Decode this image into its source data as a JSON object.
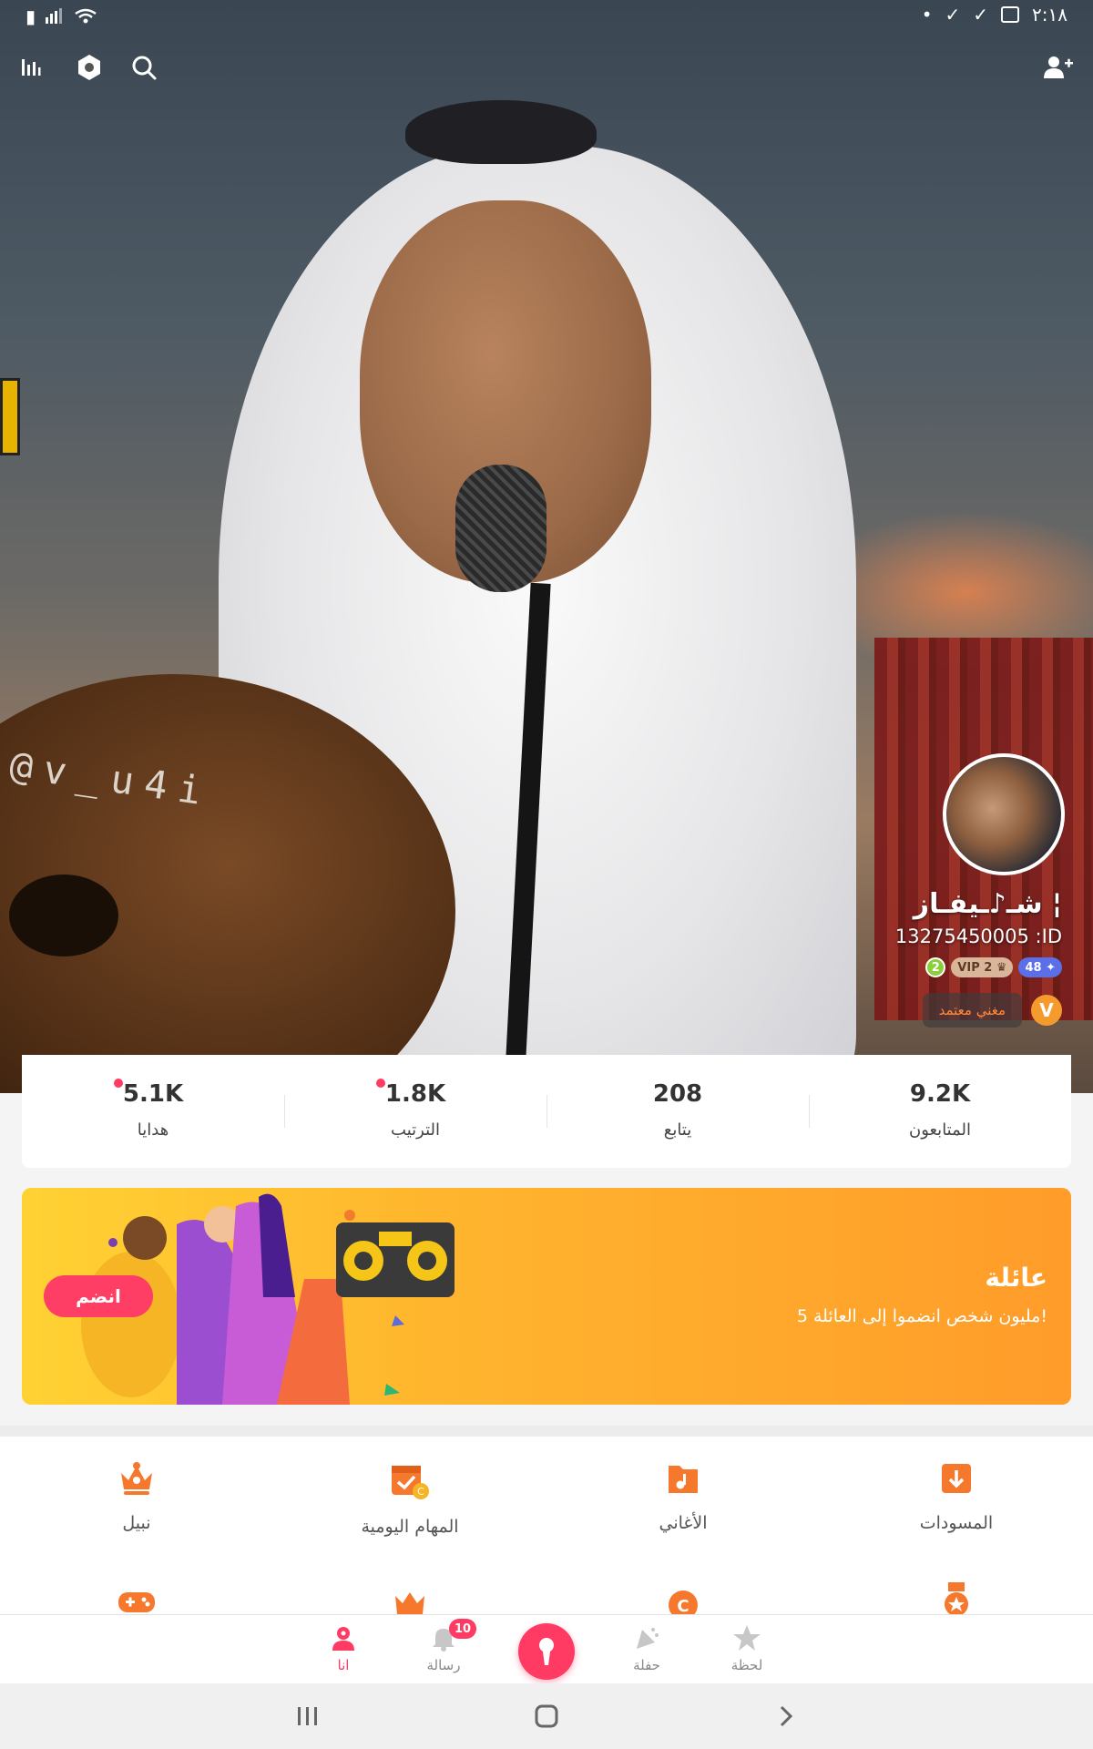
{
  "status_bar": {
    "time": "٢:١٨"
  },
  "toolbar": {
    "left_icons": [
      "stats-icon",
      "settings-icon",
      "search-icon"
    ],
    "right_icon": "add-friend-icon"
  },
  "hero": {
    "watermark": "@v_u4i"
  },
  "profile": {
    "username": "شـ♪ـيفـاز ¦",
    "id_text": "13275450005 :ID",
    "level_badge": "2",
    "vip_badge": "VIP 2",
    "fans_badge": "48",
    "verified_label": "مغني معتمد",
    "verified_icon": "V"
  },
  "stats": [
    {
      "value": "5.1K",
      "label": "هدايا",
      "dot": true
    },
    {
      "value": "1.8K",
      "label": "الترتيب",
      "dot": true
    },
    {
      "value": "208",
      "label": "يتابع",
      "dot": false
    },
    {
      "value": "9.2K",
      "label": "المتابعون",
      "dot": false
    }
  ],
  "banner": {
    "title": "عائلة",
    "subtitle": "5 مليون شخص انضموا إلى العائلة!",
    "join_label": "انضم",
    "gradient": [
      "#ffd233",
      "#ff9c2a"
    ]
  },
  "grid": {
    "row1": [
      {
        "label": "نبيل",
        "icon": "crown-icon"
      },
      {
        "label": "المهام اليومية",
        "icon": "daily-tasks-icon"
      },
      {
        "label": "الأغاني",
        "icon": "songs-icon"
      },
      {
        "label": "المسودات",
        "icon": "drafts-icon"
      }
    ],
    "row2": [
      {
        "icon": "game-icon"
      },
      {
        "icon": "crown-outline-icon"
      },
      {
        "icon": "coin-icon"
      },
      {
        "icon": "medal-icon"
      }
    ]
  },
  "bottom_nav": {
    "items": [
      {
        "label": "انا",
        "icon": "profile-icon",
        "active": true
      },
      {
        "label": "رسالة",
        "icon": "bell-icon",
        "badge": "10"
      },
      {
        "label": "",
        "icon": "mic-icon"
      },
      {
        "label": "حفلة",
        "icon": "party-icon"
      },
      {
        "label": "لحظة",
        "icon": "star-icon"
      }
    ]
  },
  "colors": {
    "accent": "#ff3a63",
    "orange": "#f5782d",
    "banner_start": "#ffd233",
    "banner_end": "#ff9c2a"
  }
}
